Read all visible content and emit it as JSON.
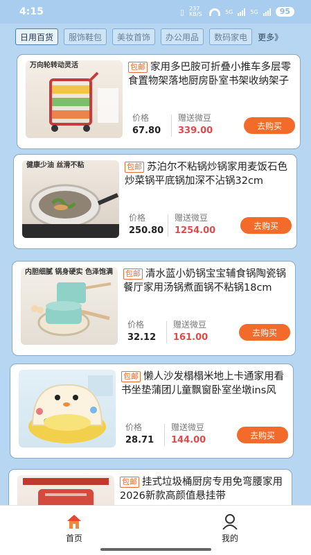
{
  "status": {
    "time": "4:15",
    "net_speed": "237 KB/S",
    "signal1": "5G",
    "signal2": "5G",
    "battery": "95"
  },
  "tabs": [
    "日用百货",
    "服饰鞋包",
    "美妆首饰",
    "办公用品",
    "数码家电"
  ],
  "tabs_more": "更多》",
  "labels": {
    "badge": "包邮",
    "price": "价格",
    "bean": "赠送微豆",
    "buy": "去购买"
  },
  "products": [
    {
      "title": "家用多巴胺可折叠小推车多层零食置物架落地厨房卧室书架收纳架子",
      "price": "67.80",
      "bean": "339.00",
      "banner": "万向轮转动灵活"
    },
    {
      "title": "苏泊尔不粘锅炒锅家用麦饭石色炒菜锅平底锅加深不沾锅32cm",
      "price": "250.80",
      "bean": "1254.00",
      "banner": "健康少油 丝滑不粘"
    },
    {
      "title": "清水蓝小奶锅宝宝辅食锅陶瓷锅餐厅家用汤锅煮面锅不粘锅18cm",
      "price": "32.12",
      "bean": "161.00",
      "banner": "内胆细腻 锅身硬实 色泽饱满"
    },
    {
      "title": "懒人沙发榻榻米地上卡通家用看书坐垫蒲团儿童飘窗卧室坐墩ins风",
      "price": "28.71",
      "bean": "144.00",
      "banner": ""
    },
    {
      "title": "挂式垃圾桶厨房专用免弯腰家用2026新款高颜值悬挂带",
      "price": "",
      "bean": "",
      "banner": ""
    }
  ],
  "nav": {
    "home": "首页",
    "me": "我的"
  },
  "colors": {
    "accent": "#f26b2a",
    "bean": "#e04a4a",
    "background": "#b7d6f1"
  }
}
